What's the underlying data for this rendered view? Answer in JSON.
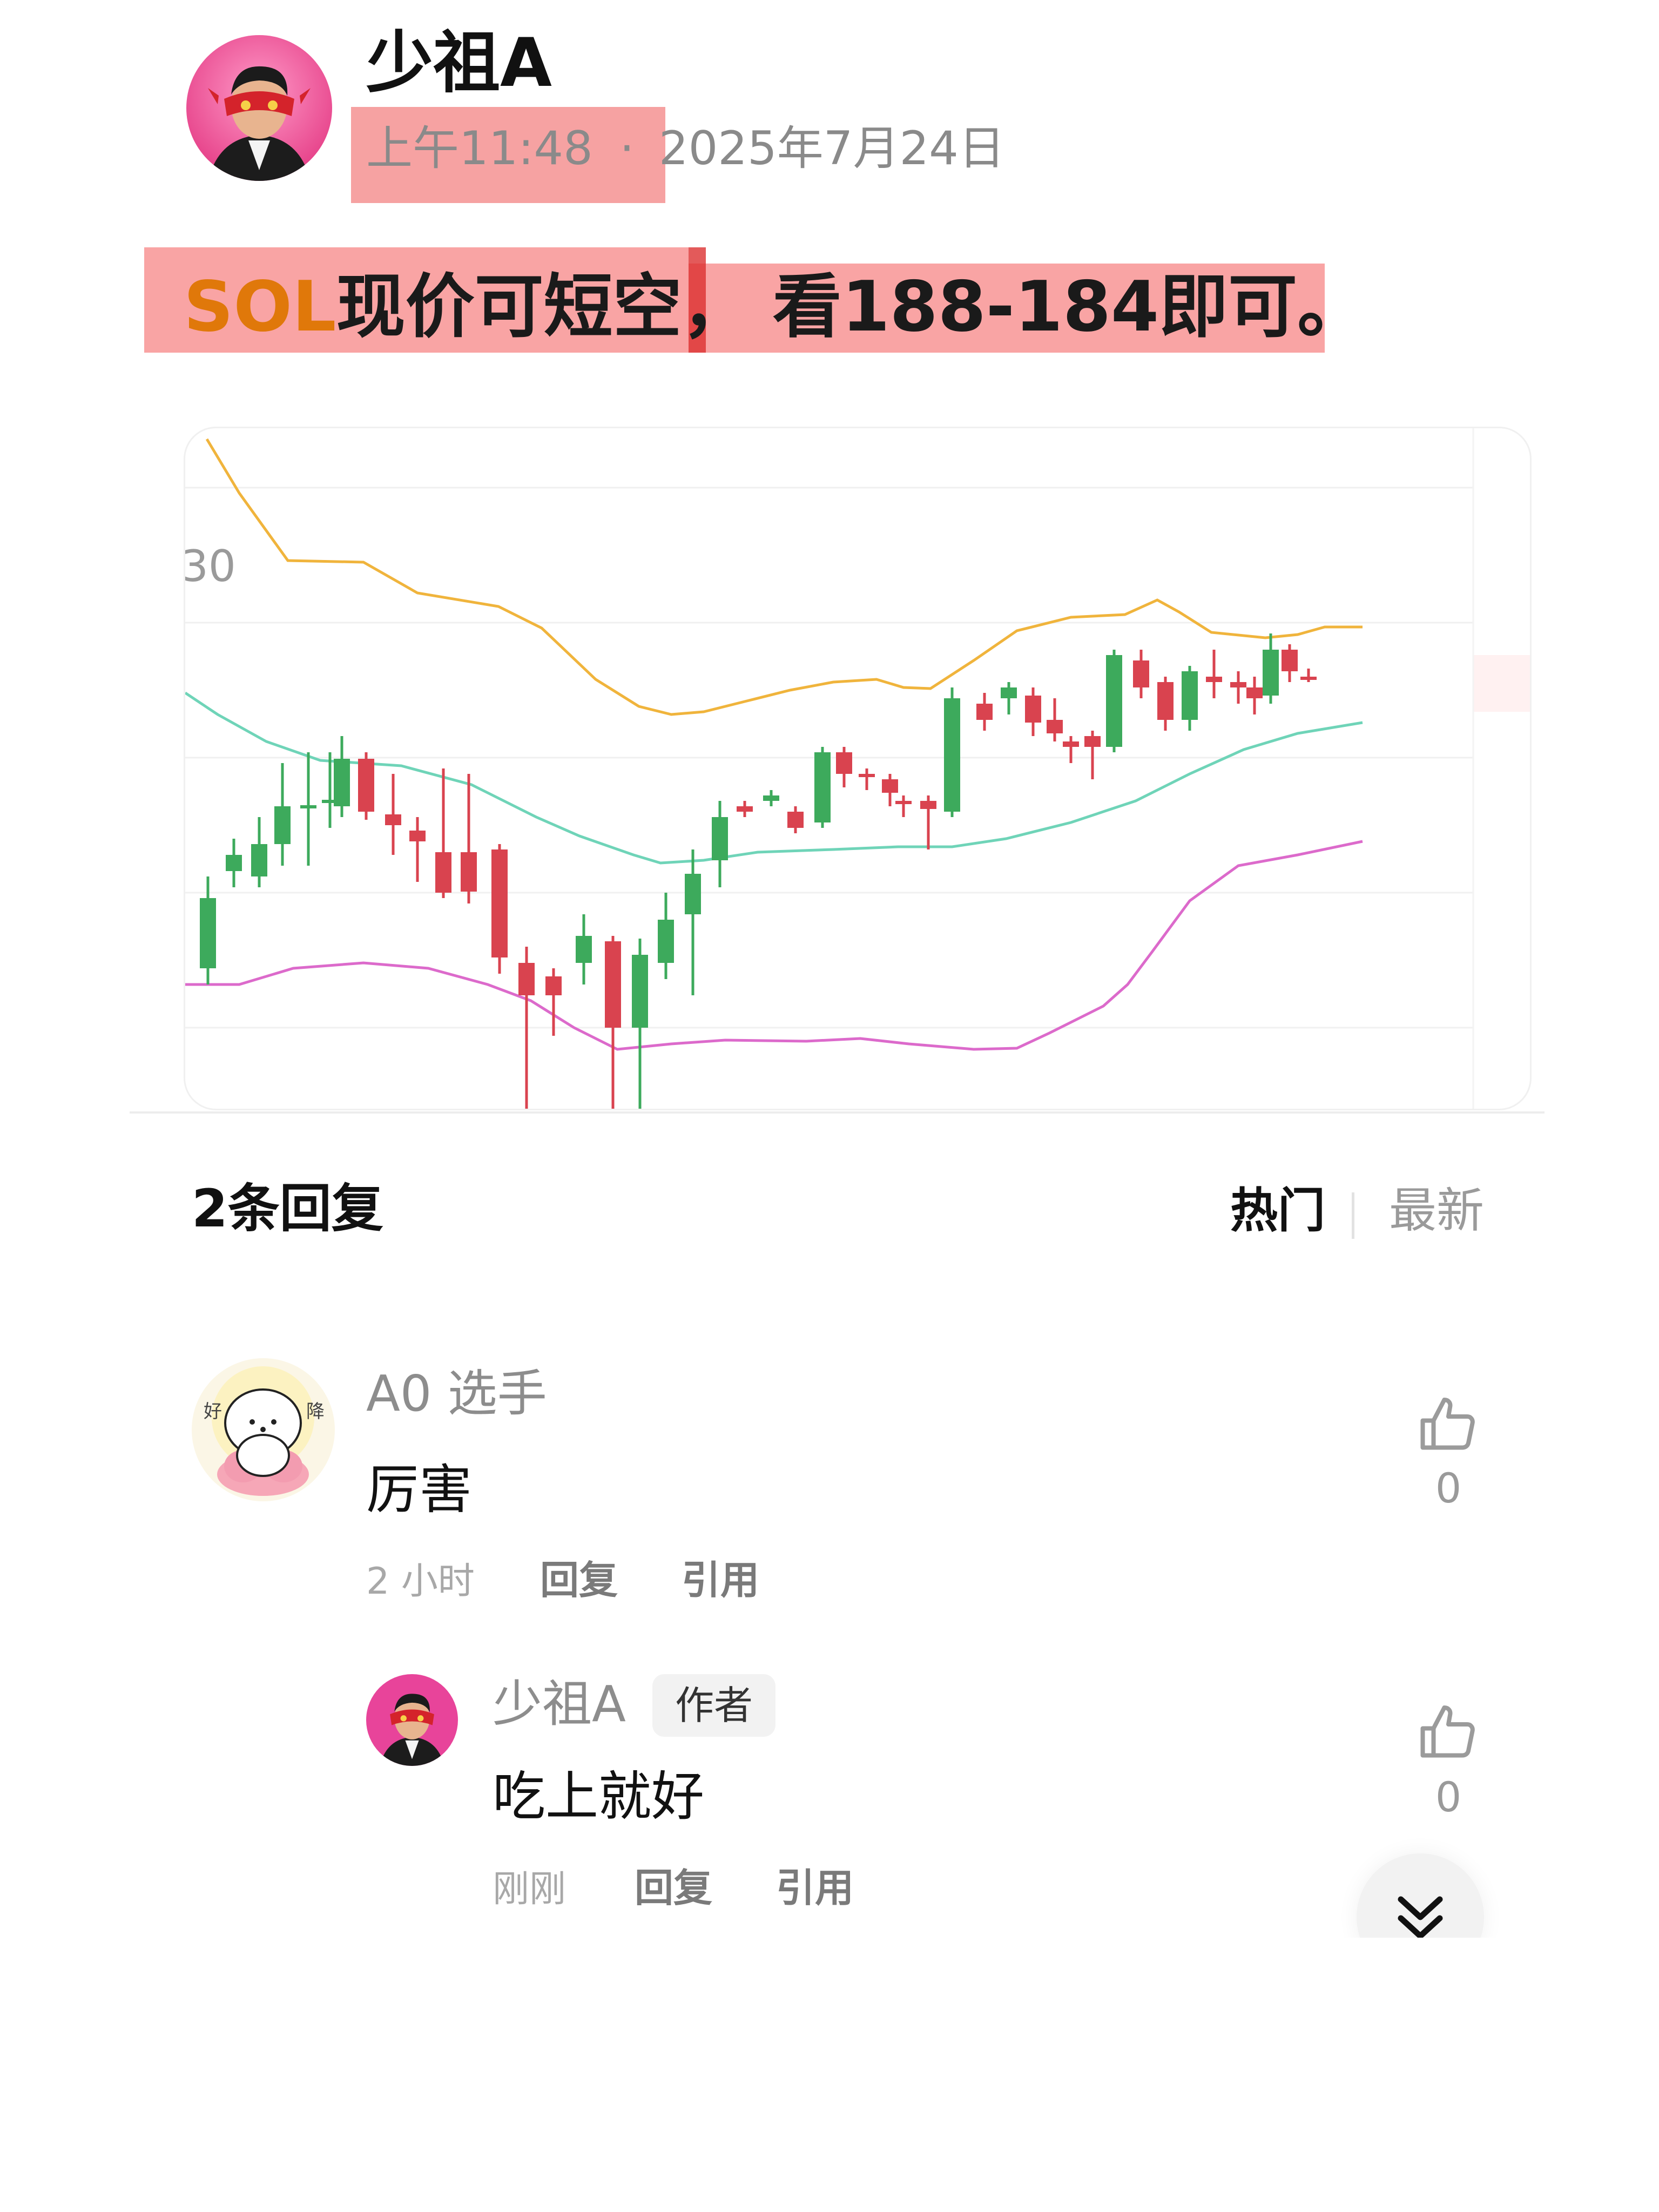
{
  "post": {
    "author": "少祖A",
    "time": "上午11:48",
    "separator": "·",
    "date": "2025年7月24日",
    "text_symbol": "SOL",
    "text_part1": "现价可短空，",
    "text_part2": "看188-184即可。"
  },
  "chart": {
    "price_tick_label": "30",
    "bullish_color": "#3daa5c",
    "bearish_color": "#d9434f",
    "upper_band_color": "#f0b43c",
    "middle_band_color": "#6fd4b8",
    "lower_band_color": "#dc6acb"
  },
  "replies": {
    "count_label": "2条回复",
    "sort_hot": "热门",
    "sort_new": "最新"
  },
  "comments": [
    {
      "user": "A0 选手",
      "body": "厉害",
      "time": "2 小时",
      "reply_label": "回复",
      "quote_label": "引用",
      "likes": "0"
    },
    {
      "user": "少祖A",
      "badge": "作者",
      "body": "吃上就好",
      "time": "刚刚",
      "reply_label": "回复",
      "quote_label": "引用",
      "likes": "0"
    }
  ],
  "icons": {
    "like": "thumbs-up-icon",
    "scroll": "double-chevron-down-icon"
  }
}
